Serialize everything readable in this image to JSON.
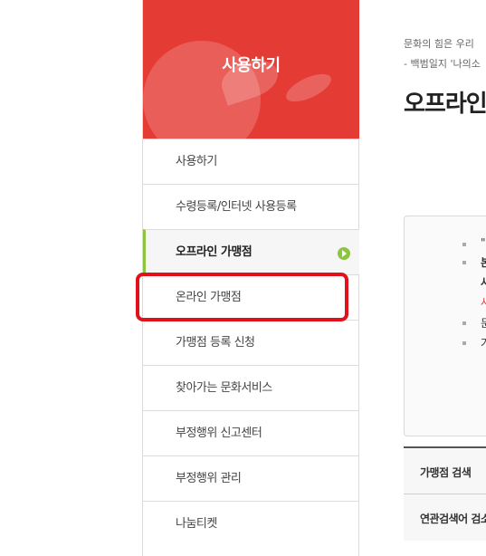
{
  "sidebar": {
    "title": "사용하기",
    "items": [
      {
        "label": "사용하기",
        "active": false
      },
      {
        "label": "수령등록/인터넷 사용등록",
        "active": false
      },
      {
        "label": "오프라인 가맹점",
        "active": true
      },
      {
        "label": "온라인 가맹점",
        "active": false,
        "highlighted": true
      },
      {
        "label": "가맹점 등록 신청",
        "active": false
      },
      {
        "label": "찾아가는 문화서비스",
        "active": false
      },
      {
        "label": "부정행위 신고센터",
        "active": false
      },
      {
        "label": "부정행위 관리",
        "active": false
      },
      {
        "label": "나눔티켓",
        "active": false
      }
    ]
  },
  "main": {
    "quote_line1": "문화의 힘은 우리",
    "quote_line2": "- 백범일지 '나의소",
    "page_title": "오프라인",
    "notice_fragments": [
      "\"",
      "본",
      "사",
      "사",
      "문",
      "가"
    ],
    "search_labels": [
      "가맹점 검색",
      "연관검색어 검소"
    ]
  },
  "colors": {
    "header_red": "#e53b35",
    "active_green": "#8cc63f",
    "highlight_red": "#e2101a"
  }
}
